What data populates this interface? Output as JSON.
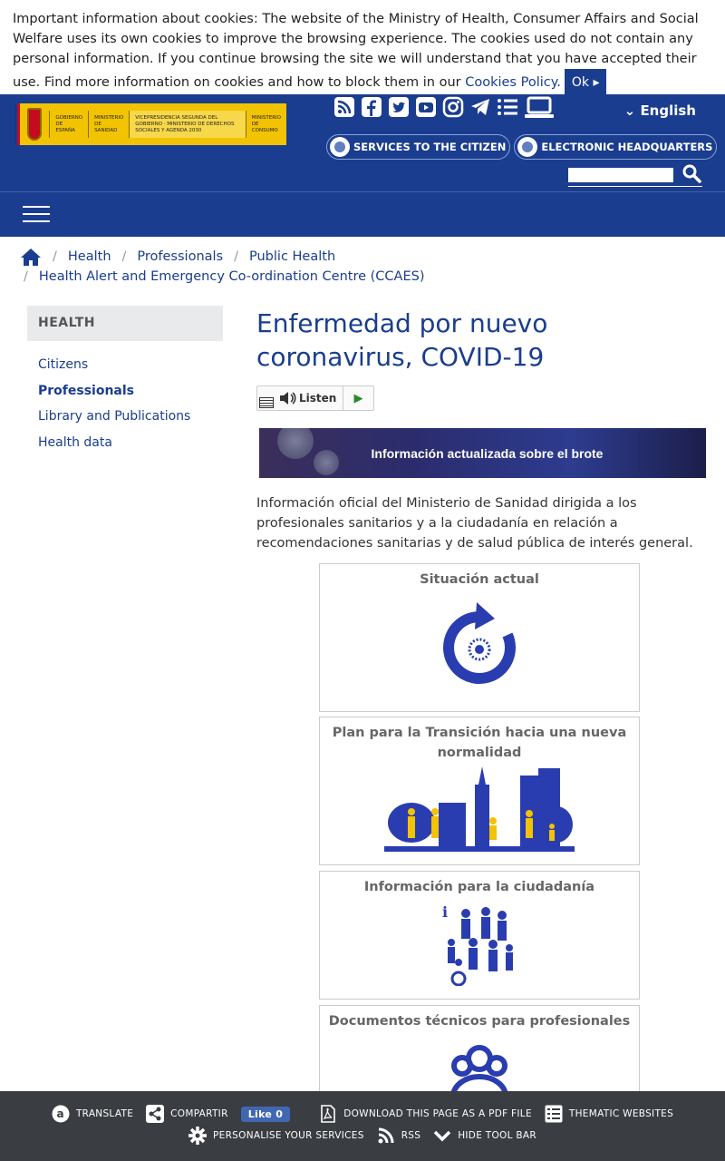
{
  "cookie": {
    "text": "Important information about cookies: The website of the Ministry of Health, Consumer Affairs and Social Welfare uses its own cookies to improve the browsing experience. The cookies used do not contain any personal information. If you continue browsing the site we will understand that you have accepted their use. Find more information on cookies and how to block them in our ",
    "link": "Cookies Policy",
    "ok": "Ok"
  },
  "header": {
    "logo_text_1": "GOBIERNO DE ESPAÑA",
    "logo_text_2": "MINISTERIO DE SANIDAD",
    "logo_text_3": "VICEPRESIDENCIA SEGUNDA DEL GOBIERNO · MINISTERIO DE DERECHOS SOCIALES Y AGENDA 2030",
    "logo_text_4": "MINISTERIO DE CONSUMO",
    "language": "English",
    "services": "SERVICES TO THE CITIZEN",
    "headquarters": "ELECTRONIC HEADQUARTERS"
  },
  "breadcrumb": {
    "items": [
      "Health",
      "Professionals",
      "Public Health",
      "Health Alert and Emergency Co-ordination Centre (CCAES)"
    ]
  },
  "sidebar": {
    "heading": "HEALTH",
    "items": [
      {
        "label": "Citizens"
      },
      {
        "label": "Professionals"
      },
      {
        "label": "Library and Publications"
      },
      {
        "label": "Health data"
      }
    ]
  },
  "main": {
    "title": "Enfermedad por nuevo coronavirus, COVID-19",
    "listen": "Listen",
    "banner": "Información actualizada sobre el brote",
    "intro": "Información oficial del Ministerio de Sanidad dirigida a los profesionales sanitarios y a la ciudadanía en relación a recomendaciones sanitarias y de salud pública de interés general.",
    "cards": [
      {
        "title": "Situación actual"
      },
      {
        "title": "Plan para la Transición hacia una nueva normalidad"
      },
      {
        "title": "Información para la ciudadanía"
      },
      {
        "title": "Documentos técnicos para profesionales"
      }
    ]
  },
  "toolbar": {
    "translate": "TRANSLATE",
    "share": "COMPARTIR",
    "like": "Like 0",
    "pdf": "DOWNLOAD THIS PAGE AS A PDF FILE",
    "thematic": "THEMATIC WEBSITES",
    "personalise": "PERSONALISE YOUR SERVICES",
    "rss": "RSS",
    "hide": "HIDE TOOL BAR"
  },
  "colors": {
    "brand_blue": "#1a3d8f",
    "toolbar_bg": "#3a3d42",
    "logo_yellow": "#f2c300"
  }
}
